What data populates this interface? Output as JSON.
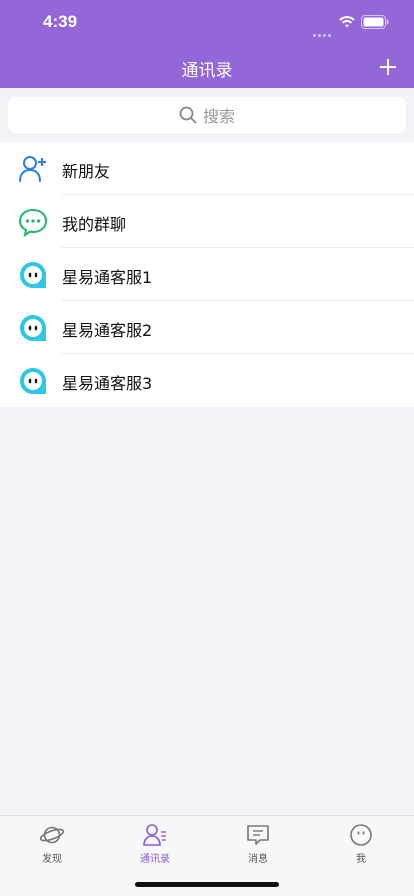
{
  "status": {
    "time": "4:39"
  },
  "header": {
    "title": "通讯录",
    "add_icon": "plus-icon"
  },
  "search": {
    "placeholder": "搜索"
  },
  "list": [
    {
      "label": "新朋友",
      "icon": "add-friend-icon"
    },
    {
      "label": "我的群聊",
      "icon": "group-chat-icon"
    },
    {
      "label": "星易通客服1",
      "icon": "service-bot-icon"
    },
    {
      "label": "星易通客服2",
      "icon": "service-bot-icon"
    },
    {
      "label": "星易通客服3",
      "icon": "service-bot-icon"
    }
  ],
  "tabs": [
    {
      "label": "发现",
      "icon": "planet-icon",
      "active": false
    },
    {
      "label": "通讯录",
      "icon": "contacts-icon",
      "active": true
    },
    {
      "label": "消息",
      "icon": "message-icon",
      "active": false
    },
    {
      "label": "我",
      "icon": "profile-icon",
      "active": false
    }
  ],
  "colors": {
    "header": "#9467d9",
    "active_tab": "#8a5bd6",
    "friend_icon": "#2d7de9",
    "group_icon": "#1fb86a",
    "service_icon": "#2bc7e4"
  }
}
